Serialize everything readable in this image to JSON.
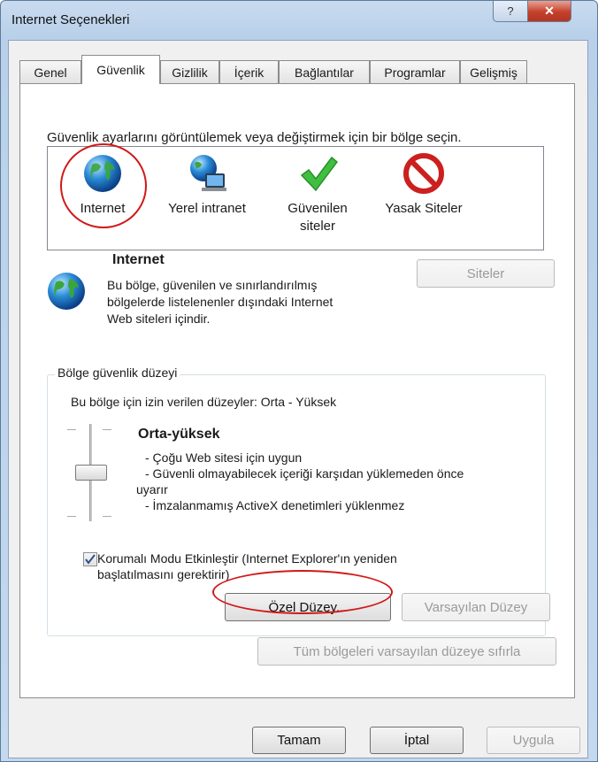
{
  "window": {
    "title": "Internet Seçenekleri",
    "help_label": "?",
    "close_label": "✕"
  },
  "tabs": [
    "Genel",
    "Güvenlik",
    "Gizlilik",
    "İçerik",
    "Bağlantılar",
    "Programlar",
    "Gelişmiş"
  ],
  "active_tab": "Güvenlik",
  "security": {
    "instruction": "Güvenlik ayarlarını görüntülemek veya değiştirmek için bir bölge seçin.",
    "zones": [
      {
        "label": "Internet",
        "icon": "globe-icon"
      },
      {
        "label": "Yerel intranet",
        "icon": "intranet-computer-icon"
      },
      {
        "label": "Güvenilen",
        "label2": "siteler",
        "icon": "green-check-icon"
      },
      {
        "label": "Yasak Siteler",
        "icon": "no-entry-icon"
      }
    ],
    "selected_zone": {
      "name": "Internet",
      "description_lines": [
        "Bu bölge, güvenilen ve sınırlandırılmış",
        "bölgelerde listelenenler dışındaki Internet",
        "Web siteleri içindir."
      ]
    },
    "sites_button": "Siteler"
  },
  "level_group": {
    "legend": "Bölge güvenlik düzeyi",
    "allowed_levels": "Bu bölge için izin verilen düzeyler: Orta - Yüksek",
    "level_name": "Orta-yüksek",
    "details": [
      "- Çoğu Web sitesi için uygun",
      "- Güvenli olmayabilecek içeriği karşıdan yüklemeden önce",
      "uyarır",
      "- İmzalanmamış ActiveX denetimleri yüklenmez"
    ],
    "slider_level": "Orta-yüksek",
    "protected_mode": {
      "checked": true,
      "line1": "Korumalı Modu Etkinleştir (Internet Explorer'ın yeniden",
      "line2": "başlatılmasını gerektirir)"
    },
    "custom_level_button": "Özel Düzey...",
    "default_level_button": "Varsayılan Düzey"
  },
  "reset_all_button": "Tüm bölgeleri varsayılan düzeye sıfırla",
  "footer": {
    "ok": "Tamam",
    "cancel": "İptal",
    "apply": "Uygula"
  },
  "colors": {
    "annotation": "#d11919",
    "title_bar": "#c9dbef"
  }
}
